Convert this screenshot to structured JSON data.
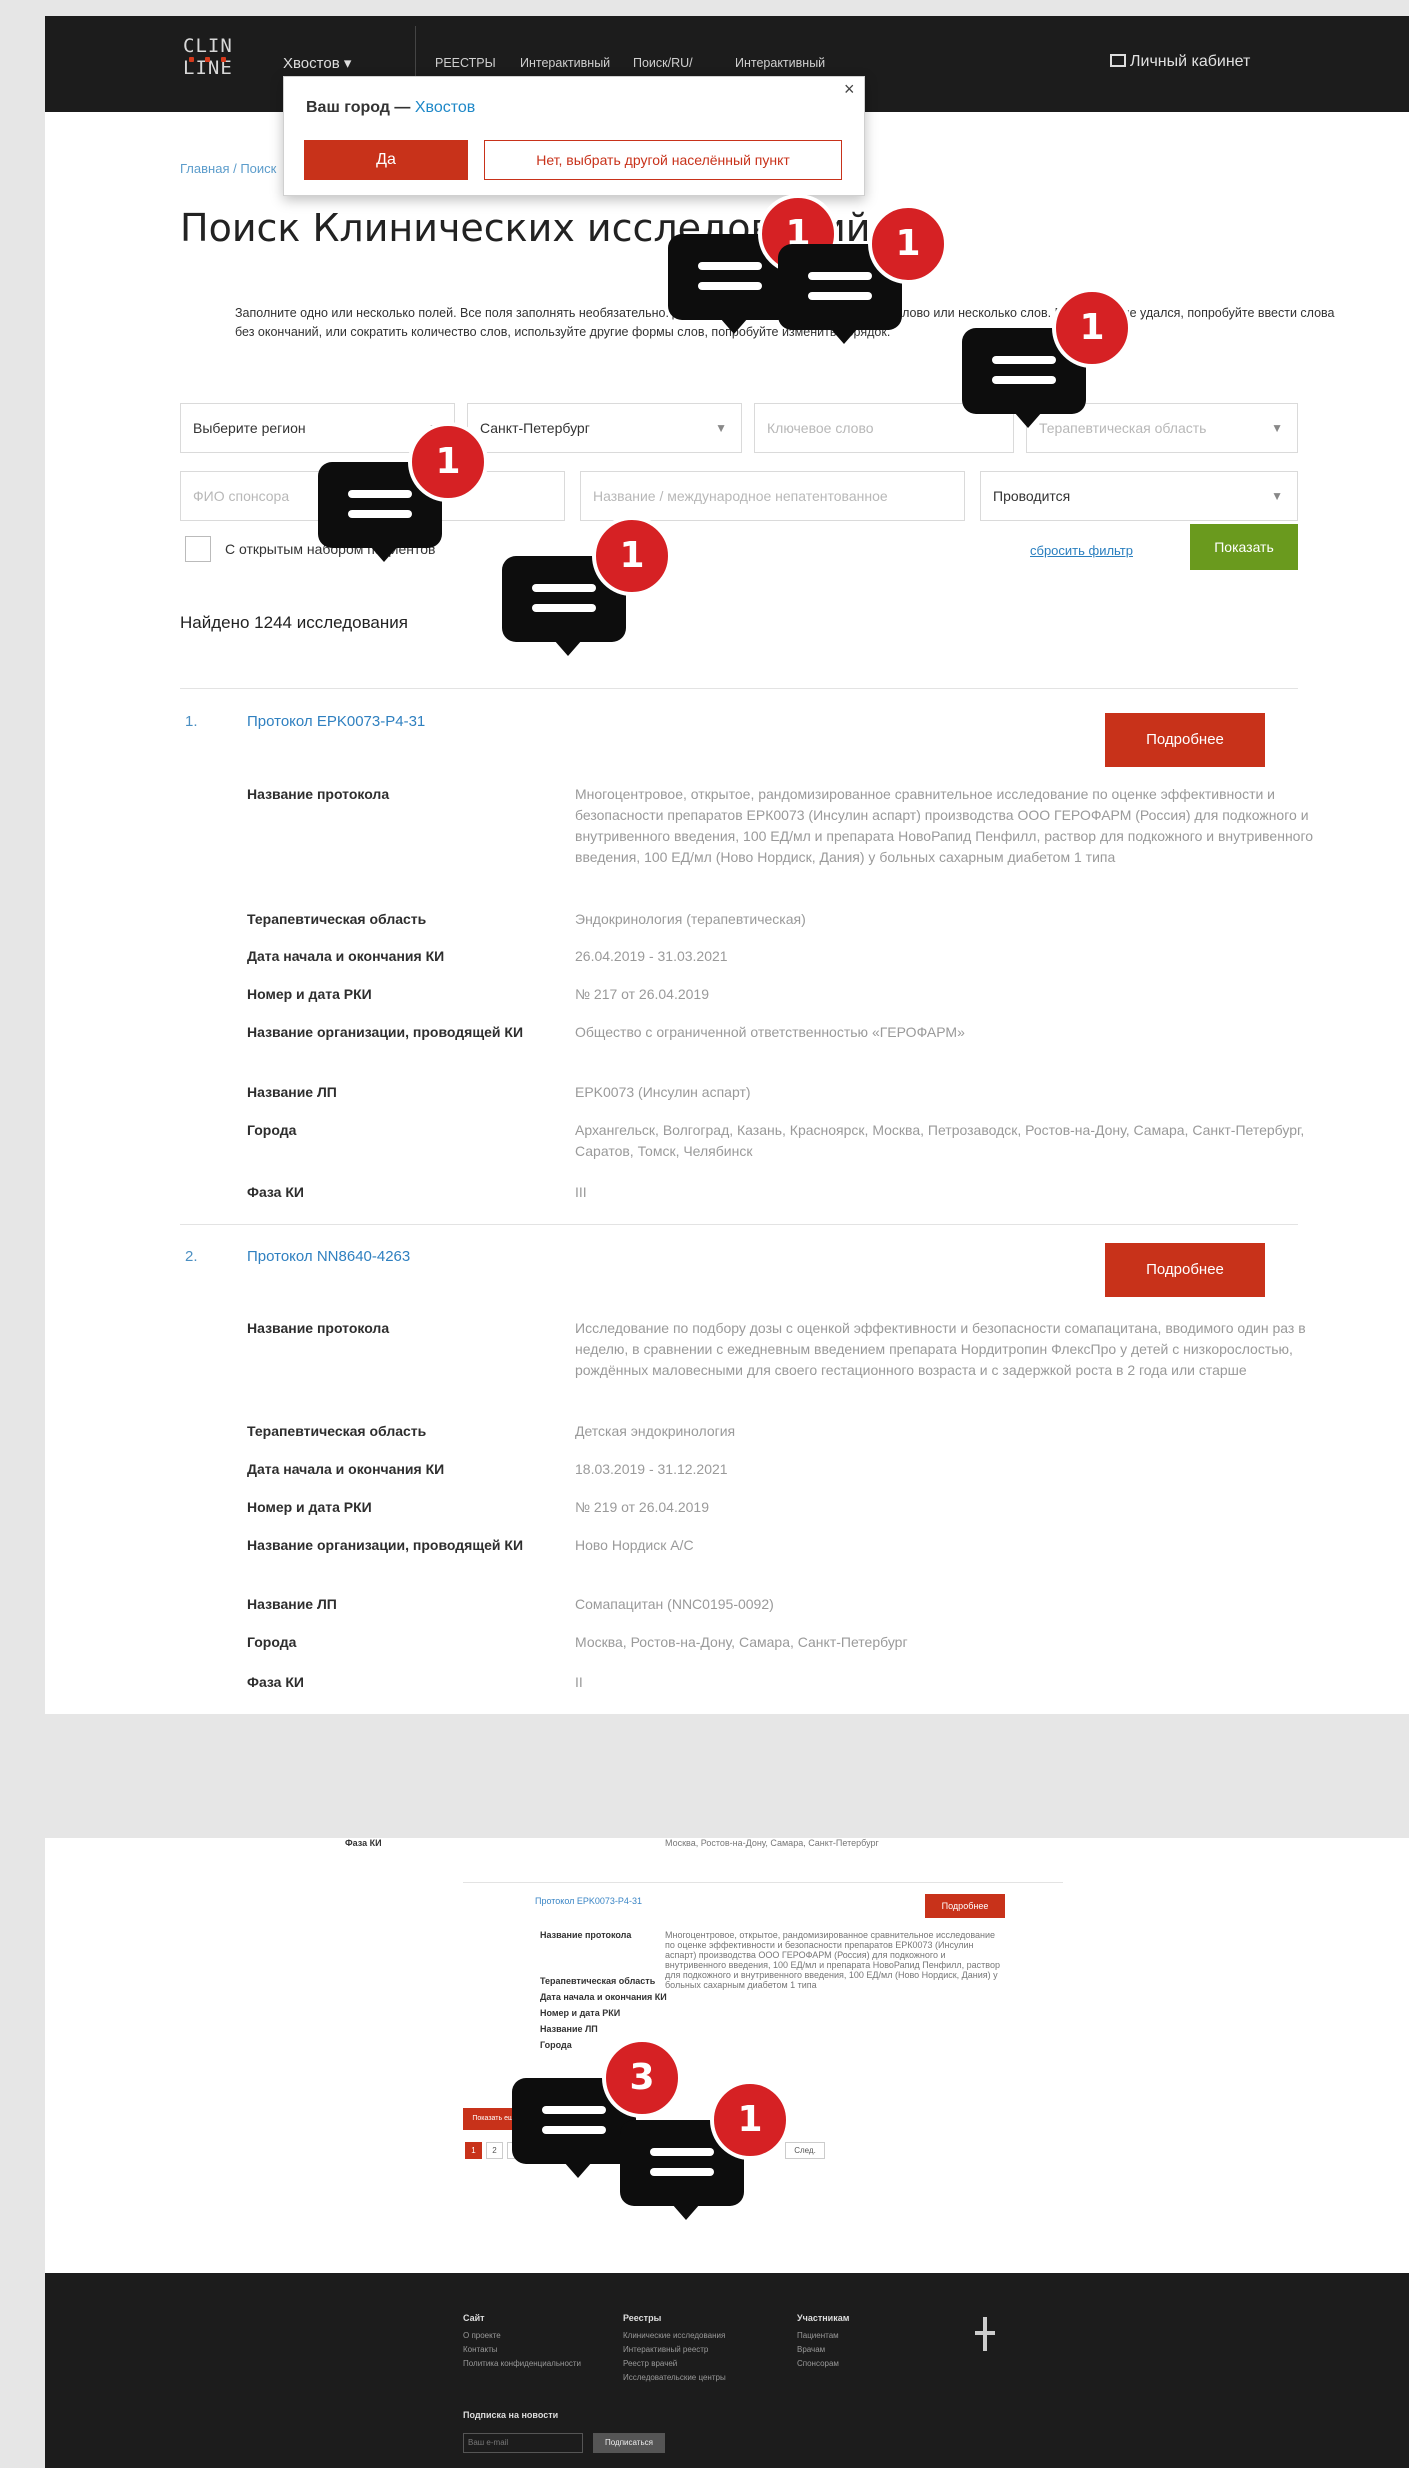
{
  "header": {
    "city_switch": "Хвостов ▾",
    "nav": [
      "РЕЕСТРЫ",
      "Интерактивный",
      "Поиск/RU/",
      "Интерактивный"
    ],
    "cabinet": "Личный кабинет"
  },
  "city_popup": {
    "question_prefix": "Ваш город — ",
    "city": "Хвостов",
    "close": "×",
    "yes": "Да",
    "no": "Нет, выбрать другой населённый пункт"
  },
  "breadcrumb": "Главная / Поиск",
  "page_title": "Поиск Клинических исследований",
  "intro": "Заполните одно или несколько полей. Все поля заполнять необязательно. Для поиска можно использовать одно слово или несколько слов. Если поиск не удался, попробуйте ввести слова без окончаний, или сократить количество слов, используйте другие формы слов, попробуйте изменить порядок.",
  "filters": {
    "region": "Выберите регион",
    "city": "Санкт-Петербург",
    "keyword_placeholder": "Ключевое слово",
    "therapeutic_placeholder": "Терапевтическая область",
    "sponsor_placeholder": "ФИО спонсора",
    "drug_placeholder": "Название / международное непатентованное",
    "status": "Проводится"
  },
  "checkbox_label": "С открытым набором пациентов",
  "reset": "сбросить фильтр",
  "show": "Показать",
  "found": "Найдено 1244 исследования",
  "results": [
    {
      "num": "1.",
      "title": "Протокол EPK0073-P4-31",
      "more": "Подробнее",
      "fields": [
        {
          "label": "Название протокола",
          "value": "Многоцентровое, открытое, рандомизированное сравнительное исследование по оценке эффективности и безопасности препаратов ЕРК0073 (Инсулин аспарт) производства ООО ГЕРОФАРМ (Россия) для подкожного и внутривенного введения, 100 ЕД/мл и препарата НовоРапид Пенфилл, раствор для подкожного и внутривенного введения, 100 ЕД/мл (Ново Нордиск, Дания) у больных сахарным диабетом 1 типа"
        },
        {
          "label": "Терапевтическая область",
          "value": "Эндокринология (терапевтическая)"
        },
        {
          "label": "Дата начала и окончания КИ",
          "value": "26.04.2019 - 31.03.2021"
        },
        {
          "label": "Номер и дата РКИ",
          "value": "№ 217 от 26.04.2019"
        },
        {
          "label": "Название организации, проводящей КИ",
          "value": "Общество с ограниченной ответственностью «ГЕРОФАРМ»"
        },
        {
          "label": "Название ЛП",
          "value": "EPK0073 (Инсулин аспарт)"
        },
        {
          "label": "Города",
          "value": "Архангельск, Волгоград, Казань, Красноярск, Москва, Петрозаводск, Ростов-на-Дону, Самара, Санкт-Петербург, Саратов, Томск, Челябинск"
        },
        {
          "label": "Фаза КИ",
          "value": "III"
        }
      ]
    },
    {
      "num": "2.",
      "title": "Протокол NN8640-4263",
      "more": "Подробнее",
      "fields": [
        {
          "label": "Название протокола",
          "value": "Исследование по подбору дозы с оценкой эффективности и безопасности сомапацитана, вводимого один раз в неделю, в сравнении с ежедневным введением препарата Нордитропин ФлексПро у детей с низкорослостью, рождённых маловесными для своего гестационного возраста и с задержкой роста в 2 года или старше"
        },
        {
          "label": "Терапевтическая область",
          "value": "Детская эндокринология"
        },
        {
          "label": "Дата начала и окончания КИ",
          "value": "18.03.2019 - 31.12.2021"
        },
        {
          "label": "Номер и дата РКИ",
          "value": "№ 219 от 26.04.2019"
        },
        {
          "label": "Название организации, проводящей КИ",
          "value": "Ново Нордиск А/С"
        },
        {
          "label": "Название ЛП",
          "value": "Сомапацитан (NNC0195-0092)"
        },
        {
          "label": "Города",
          "value": "Москва, Ростов-на-Дону, Самара, Санкт-Петербург"
        },
        {
          "label": "Фаза КИ",
          "value": "II"
        }
      ]
    }
  ],
  "feedback_badges": [
    "1",
    "1",
    "1",
    "1",
    "1",
    "3",
    "1"
  ],
  "bottom": {
    "more": "Подробнее",
    "show_more": "Показать ещё",
    "pages": [
      "1",
      "2",
      "3",
      "4",
      "5"
    ],
    "next": "След.",
    "footer": {
      "col1": {
        "title": "Сайт",
        "items": [
          "О проекте",
          "Контакты",
          "Политика конфиденциальности"
        ]
      },
      "col2": {
        "title": "Реестры",
        "items": [
          "Клинические исследования",
          "Интерактивный реестр",
          "Реестр врачей",
          "Исследовательские центры"
        ]
      },
      "col3": {
        "title": "Участникам",
        "items": [
          "Пациентам",
          "Врачам",
          "Спонсорам"
        ]
      },
      "subscribe_title": "Подписка на новости",
      "email_placeholder": "Ваш e-mail",
      "subscribe_btn": "Подписаться"
    }
  }
}
